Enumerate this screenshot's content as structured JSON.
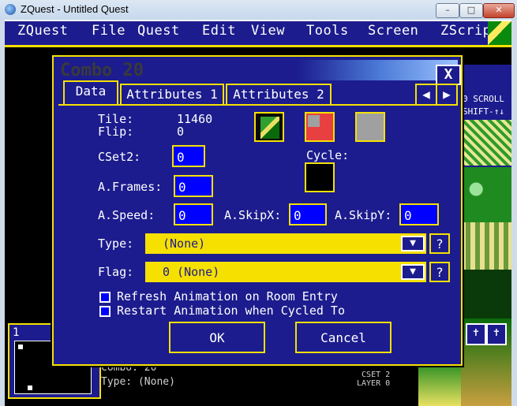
{
  "window": {
    "title": "ZQuest - Untitled Quest",
    "min_label": "–",
    "max_label": "□",
    "close_label": "✕"
  },
  "menu": {
    "items": [
      {
        "label": "ZQuest"
      },
      {
        "label": "File"
      },
      {
        "label": "Quest"
      },
      {
        "label": "Edit"
      },
      {
        "label": "View"
      },
      {
        "label": "Tools"
      },
      {
        "label": "Screen"
      },
      {
        "label": "ZScrip"
      }
    ]
  },
  "right_panel": {
    "scroll_line1": "0 SCROLL",
    "scroll_line2": "SHIFT-↑↓"
  },
  "dialog": {
    "title": "Combo 20",
    "close_label": "X",
    "tabs": {
      "data": "Data",
      "attr1": "Attributes 1",
      "attr2": "Attributes 2",
      "left": "◀",
      "right": "▶"
    },
    "tile_label": "Tile:",
    "tile_value": "11460",
    "flip_label": "Flip:",
    "flip_value": "0",
    "cset2_label": "CSet2:",
    "cset2_value": "0",
    "cycle_label": "Cycle:",
    "aframes_label": "A.Frames:",
    "aframes_value": "0",
    "aspeed_label": "A.Speed:",
    "aspeed_value": "0",
    "askipx_label": "A.SkipX:",
    "askipx_value": "0",
    "askipy_label": "A.SkipY:",
    "askipy_value": "0",
    "type_label": "Type:",
    "type_value": "(None)",
    "flag_label": "Flag:",
    "flag_value": "0 (None)",
    "help_label": "?",
    "dd_arrow": "▼",
    "refresh_label": "Refresh Animation on Room Entry",
    "restart_label": "Restart Animation when Cycled To",
    "ok_label": "OK",
    "cancel_label": "Cancel"
  },
  "mini": {
    "layer_label": "1"
  },
  "status": {
    "combo_label": "Combo: 20",
    "type_label": "Type: (None)",
    "cset_label": "CSET 2",
    "layer_label": "LAYER 0"
  },
  "colors": {
    "accent": "#f5e000",
    "panel": "#1c1c8e",
    "field": "#0000ff"
  }
}
